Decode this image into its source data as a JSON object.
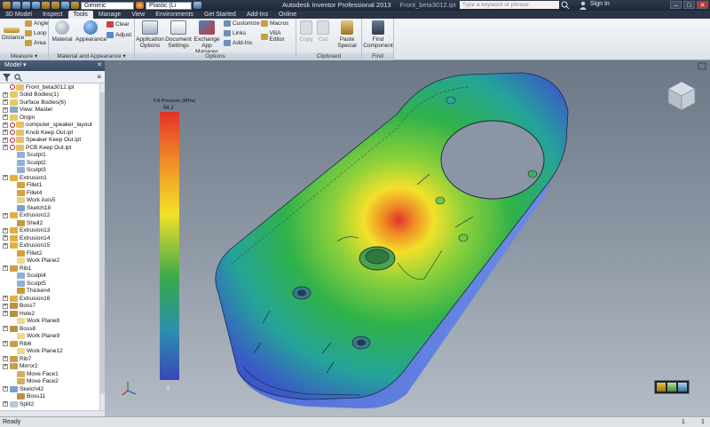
{
  "title_bar": {
    "style_dropdown": "Generic",
    "material_dropdown": "Plastic (Li",
    "app_title": "Autodesk Inventor Professional 2013",
    "file_name": "Front_beta3012.ipt",
    "search_placeholder": "Type a keyword or phrase",
    "sign_in": "Sign In"
  },
  "menu_tabs": [
    "3D Model",
    "Inspect",
    "Tools",
    "Manage",
    "View",
    "Environments",
    "Get Started",
    "Add-Ins",
    "Online"
  ],
  "active_tab": "Tools",
  "ribbon": {
    "measure": {
      "title": "Measure",
      "distance": "Distance",
      "angle": "Angle",
      "loop": "Loop",
      "area": "Area"
    },
    "material": {
      "title": "Material and Appearance",
      "material": "Material",
      "appearance": "Appearance",
      "clear": "Clear",
      "adjust": "Adjust"
    },
    "options": {
      "title": "Options",
      "app_options_1": "Application",
      "app_options_2": "Options",
      "doc_settings_1": "Document",
      "doc_settings_2": "Settings",
      "exchange_1": "Exchange",
      "exchange_2": "App Manager",
      "customize": "Customize",
      "links": "Links",
      "addins": "Add-Ins",
      "macros": "Macros",
      "vba": "VBA Editor"
    },
    "clipboard": {
      "title": "Clipboard",
      "copy": "Copy",
      "cut": "Cut",
      "paste_1": "Paste",
      "paste_2": "Special"
    },
    "find": {
      "title": "Find",
      "find_1": "Find",
      "find_2": "Component"
    }
  },
  "browser": {
    "title": "Model",
    "items": [
      {
        "label": "Front_beta3012.ipt",
        "icon": "part-icon",
        "warn": true,
        "expand": false,
        "indent": 0
      },
      {
        "label": "Solid Bodies(1)",
        "icon": "folder-icon",
        "warn": false,
        "expand": true,
        "indent": 0
      },
      {
        "label": "Surface Bodies(6)",
        "icon": "folder-icon",
        "warn": false,
        "expand": true,
        "indent": 0
      },
      {
        "label": "View: Master",
        "icon": "view-icon",
        "warn": false,
        "expand": true,
        "indent": 0
      },
      {
        "label": "Origin",
        "icon": "folder-icon",
        "warn": false,
        "expand": true,
        "indent": 0
      },
      {
        "label": "computer_speaker_layout",
        "icon": "part-icon",
        "warn": true,
        "expand": true,
        "indent": 0
      },
      {
        "label": "Knob Keep Out.ipt",
        "icon": "part-icon",
        "warn": true,
        "expand": true,
        "indent": 0
      },
      {
        "label": "Speaker Keep Out.ipt",
        "icon": "part-icon",
        "warn": true,
        "expand": true,
        "indent": 0
      },
      {
        "label": "PCB Keep Out.ipt",
        "icon": "part-icon",
        "warn": true,
        "expand": true,
        "indent": 0
      },
      {
        "label": "Sculpt1",
        "icon": "sculpt-icon",
        "warn": false,
        "expand": false,
        "indent": 1
      },
      {
        "label": "Sculpt2",
        "icon": "sculpt-icon",
        "warn": false,
        "expand": false,
        "indent": 1
      },
      {
        "label": "Sculpt3",
        "icon": "sculpt-icon",
        "warn": false,
        "expand": false,
        "indent": 1
      },
      {
        "label": "Extrusion1",
        "icon": "extrude-icon",
        "warn": false,
        "expand": true,
        "indent": 0
      },
      {
        "label": "Fillet1",
        "icon": "fillet-icon",
        "warn": false,
        "expand": false,
        "indent": 1
      },
      {
        "label": "Fillet4",
        "icon": "fillet-icon",
        "warn": false,
        "expand": false,
        "indent": 1
      },
      {
        "label": "Work Axis5",
        "icon": "axis-icon",
        "warn": false,
        "expand": false,
        "indent": 1
      },
      {
        "label": "Sketch18",
        "icon": "sketch-icon",
        "warn": false,
        "expand": false,
        "indent": 1
      },
      {
        "label": "Extrusion12",
        "icon": "extrude-icon",
        "warn": false,
        "expand": true,
        "indent": 0
      },
      {
        "label": "Shell2",
        "icon": "shell-icon",
        "warn": false,
        "expand": false,
        "indent": 1
      },
      {
        "label": "Extrusion13",
        "icon": "extrude-icon",
        "warn": false,
        "expand": true,
        "indent": 0
      },
      {
        "label": "Extrusion14",
        "icon": "extrude-icon",
        "warn": false,
        "expand": true,
        "indent": 0
      },
      {
        "label": "Extrusion15",
        "icon": "extrude-icon",
        "warn": false,
        "expand": true,
        "indent": 0
      },
      {
        "label": "Fillet2",
        "icon": "fillet-icon",
        "warn": false,
        "expand": false,
        "indent": 1
      },
      {
        "label": "Work Plane2",
        "icon": "plane-icon",
        "warn": false,
        "expand": false,
        "indent": 1
      },
      {
        "label": "Rib1",
        "icon": "rib-icon",
        "warn": false,
        "expand": true,
        "indent": 0
      },
      {
        "label": "Sculpt4",
        "icon": "sculpt-icon",
        "warn": false,
        "expand": false,
        "indent": 1
      },
      {
        "label": "Sculpt5",
        "icon": "sculpt-icon",
        "warn": false,
        "expand": false,
        "indent": 1
      },
      {
        "label": "Thicken4",
        "icon": "thicken-icon",
        "warn": false,
        "expand": false,
        "indent": 1
      },
      {
        "label": "Extrusion16",
        "icon": "extrude-icon",
        "warn": false,
        "expand": true,
        "indent": 0
      },
      {
        "label": "Boss7",
        "icon": "boss-icon",
        "warn": false,
        "expand": true,
        "indent": 0
      },
      {
        "label": "Hole2",
        "icon": "hole-icon",
        "warn": false,
        "expand": true,
        "indent": 0
      },
      {
        "label": "Work Plane8",
        "icon": "plane-icon",
        "warn": false,
        "expand": false,
        "indent": 1
      },
      {
        "label": "Boss8",
        "icon": "boss-icon",
        "warn": false,
        "expand": true,
        "indent": 0
      },
      {
        "label": "Work Plane9",
        "icon": "plane-icon",
        "warn": false,
        "expand": false,
        "indent": 1
      },
      {
        "label": "Rib6",
        "icon": "rib-icon",
        "warn": false,
        "expand": true,
        "indent": 0
      },
      {
        "label": "Work Plane12",
        "icon": "plane-icon",
        "warn": false,
        "expand": false,
        "indent": 1
      },
      {
        "label": "Rib7",
        "icon": "rib-icon",
        "warn": false,
        "expand": true,
        "indent": 0
      },
      {
        "label": "Mirror2",
        "icon": "mirror-icon",
        "warn": false,
        "expand": true,
        "indent": 0
      },
      {
        "label": "Move Face1",
        "icon": "moveface-icon",
        "warn": false,
        "expand": false,
        "indent": 1
      },
      {
        "label": "Move Face2",
        "icon": "moveface-icon",
        "warn": false,
        "expand": false,
        "indent": 1
      },
      {
        "label": "Sketch42",
        "icon": "sketch-icon",
        "warn": false,
        "expand": true,
        "indent": 0
      },
      {
        "label": "Boss11",
        "icon": "boss-icon",
        "warn": false,
        "expand": false,
        "indent": 1
      },
      {
        "label": "Split2",
        "icon": "split-icon",
        "warn": false,
        "expand": true,
        "indent": 0
      }
    ]
  },
  "legend": {
    "title": "Fill Pressure (MPa)",
    "max": "54.2",
    "min": "0"
  },
  "status": {
    "left": "Ready",
    "count1": "1",
    "count2": "1"
  },
  "colors": {
    "title_bar": "#1e2736",
    "legend_top": "#e2322a",
    "legend_mid": "#f2e12a",
    "legend_low": "#3aa84a",
    "legend_bottom": "#3a46b8"
  }
}
